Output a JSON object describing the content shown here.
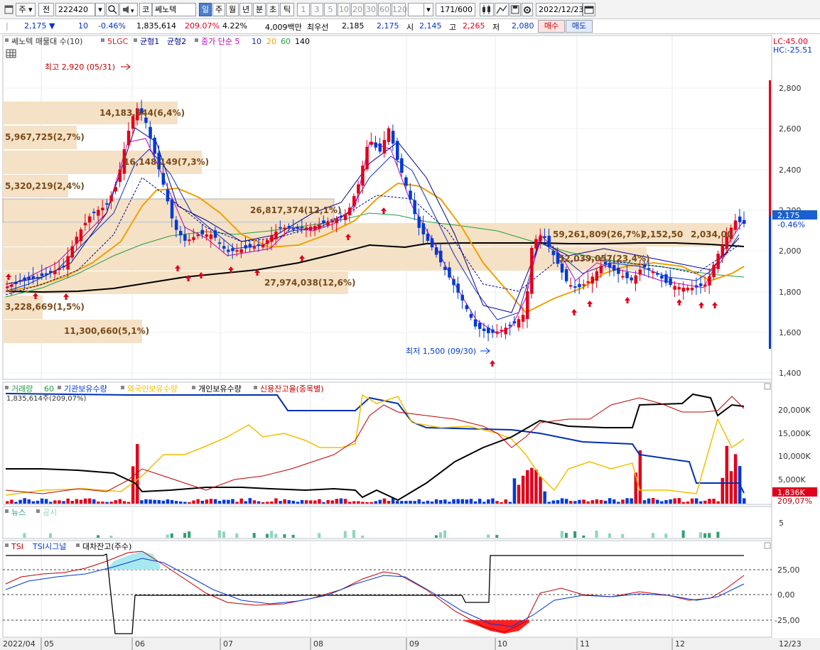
{
  "toolbar": {
    "market": "주",
    "prev": "전",
    "code": "222420",
    "market_type": "코",
    "stock_name": "쎄노텍",
    "periods": [
      "일",
      "주",
      "월",
      "년",
      "분",
      "초",
      "틱"
    ],
    "selected_period": "일",
    "intervals": [
      "1",
      "3",
      "5",
      "10",
      "20",
      "30",
      "60",
      "120"
    ],
    "count": "171",
    "count_max": "/600",
    "date": "2022/12/23"
  },
  "quote": {
    "price": "2,175",
    "change": "10",
    "change_pct": "-0.46%",
    "volume": "1,835,614",
    "volume_ratio": "209.07%",
    "turnover_rate": "4.22%",
    "amount": "4,009백만",
    "best_label": "최우선",
    "best_ask": "2,185",
    "best_bid": "2,175",
    "open_label": "시",
    "open": "2,145",
    "high_label": "고",
    "high": "2,265",
    "low_label": "저",
    "low": "2,080",
    "buy_label": "매수",
    "sell_label": "매도"
  },
  "price_panel": {
    "legend": {
      "title": "쎄노텍 매물대 수(10)",
      "items": [
        "5LGC",
        "균형1",
        "균형2",
        "종가 단순 5",
        "10",
        "20",
        "60",
        "140"
      ]
    },
    "lc": "LC:45.00",
    "hc": "HC:-25.51",
    "y_ticks": [
      "2,800",
      "2,600",
      "2,400",
      "2,200",
      "2,000",
      "1,800",
      "1,600",
      "1,400"
    ],
    "current_price_tag": "2,175",
    "current_change_tag": "-0.46%",
    "high_marker": "최고 2,920 (05/31)",
    "low_marker": "최저 1,500 (09/30)",
    "volume_profile_labels": [
      "14,183,544(6,4%)",
      "5,967,725(2,7%)",
      "16,148,149(7,3%)",
      "5,320,219(2,4%)",
      "26,817,374(12,1%)",
      "59,261,809(26,7%)",
      "2,152,50",
      "2,034,00",
      "52,039,057(23,4%)",
      "27,974,038(12,6%)",
      "3,228,669(1,5%)",
      "11,300,660(5,1%)"
    ]
  },
  "volume_panel": {
    "legend": [
      "거래량",
      "60",
      "기관보유수량",
      "외국인보유수량",
      "개인보유수량",
      "신용잔고율(종목별)"
    ],
    "sub_label": "1,835,614주(209,07%)",
    "y_ticks": [
      "20,000K",
      "15,000K",
      "10,000K",
      "5,000K"
    ],
    "tag_volume": "1,836K",
    "tag_ratio": "209,07%"
  },
  "news_panel": {
    "legend": [
      "뉴스",
      "공시"
    ],
    "y_tick": "5"
  },
  "tsi_panel": {
    "legend": [
      "TSI",
      "TSI시그널",
      "대차잔고(주수)"
    ],
    "y_ticks": [
      "25,00",
      "0,00",
      "-25,00"
    ]
  },
  "x_axis": {
    "labels": [
      "2022/04",
      "05",
      "06",
      "07",
      "08",
      "09",
      "10",
      "11",
      "12",
      "12/23"
    ]
  },
  "colors": {
    "up": "#e0001b",
    "down": "#0039d6",
    "ma5": "#c000c0",
    "ma10": "#1030c0",
    "ma20": "#f0a000",
    "ma60": "#20a040",
    "ma140": "#000000",
    "profile": "#f5e1c5"
  }
}
